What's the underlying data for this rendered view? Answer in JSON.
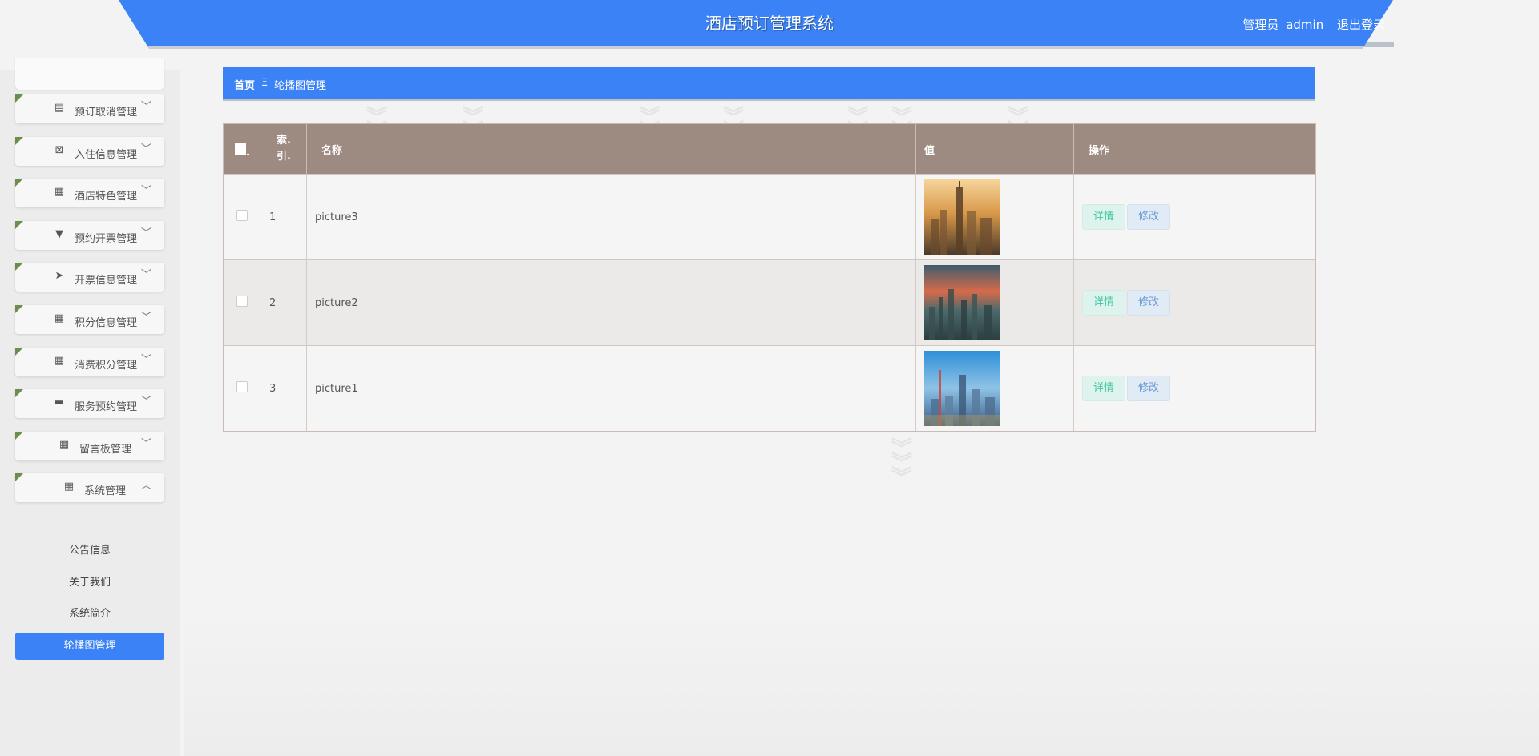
{
  "header": {
    "title": "酒店预订管理系统",
    "role_label": "管理员",
    "username": "admin",
    "logout_label": "退出登录"
  },
  "sidebar": {
    "items": [
      {
        "label": "预订取消管理",
        "icon": "clipboard-icon",
        "glyph": "▤"
      },
      {
        "label": "入住信息管理",
        "icon": "clipboard-x-icon",
        "glyph": "⊠"
      },
      {
        "label": "酒店特色管理",
        "icon": "grid-icon",
        "glyph": "▦"
      },
      {
        "label": "预约开票管理",
        "icon": "stamp-icon",
        "glyph": "▼"
      },
      {
        "label": "开票信息管理",
        "icon": "send-icon",
        "glyph": "➤"
      },
      {
        "label": "积分信息管理",
        "icon": "grid-icon",
        "glyph": "▦"
      },
      {
        "label": "消费积分管理",
        "icon": "grid-icon",
        "glyph": "▦"
      },
      {
        "label": "服务预约管理",
        "icon": "chat-icon",
        "glyph": "▬"
      },
      {
        "label": "留言板管理",
        "icon": "grid-icon",
        "glyph": "▦"
      },
      {
        "label": "系统管理",
        "icon": "grid-icon",
        "glyph": "▦"
      }
    ],
    "sub_items": [
      "公告信息",
      "关于我们",
      "系统简介",
      "轮播图管理"
    ],
    "active_sub": "轮播图管理"
  },
  "breadcrumb": {
    "home": "首页",
    "separator": "Ξ",
    "current": "轮播图管理"
  },
  "table": {
    "headers": {
      "index": "索.引.",
      "index_line1": "索.",
      "index_line2": "引.",
      "name": "名称",
      "value": "值",
      "ops": "操作"
    },
    "rows": [
      {
        "index": "1",
        "name": "picture3",
        "image": "city-sunset-blur"
      },
      {
        "index": "2",
        "name": "picture2",
        "image": "city-red-sky-blur"
      },
      {
        "index": "3",
        "name": "picture1",
        "image": "city-blue-sky-blur"
      }
    ],
    "detail_label": "详情",
    "edit_label": "修改"
  },
  "colors": {
    "primary": "#3a82f5",
    "table_header": "#9d8a80",
    "menu_corner": "#6b8e4e",
    "detail_text": "#3ec9a0",
    "edit_text": "#6a9bd8"
  }
}
